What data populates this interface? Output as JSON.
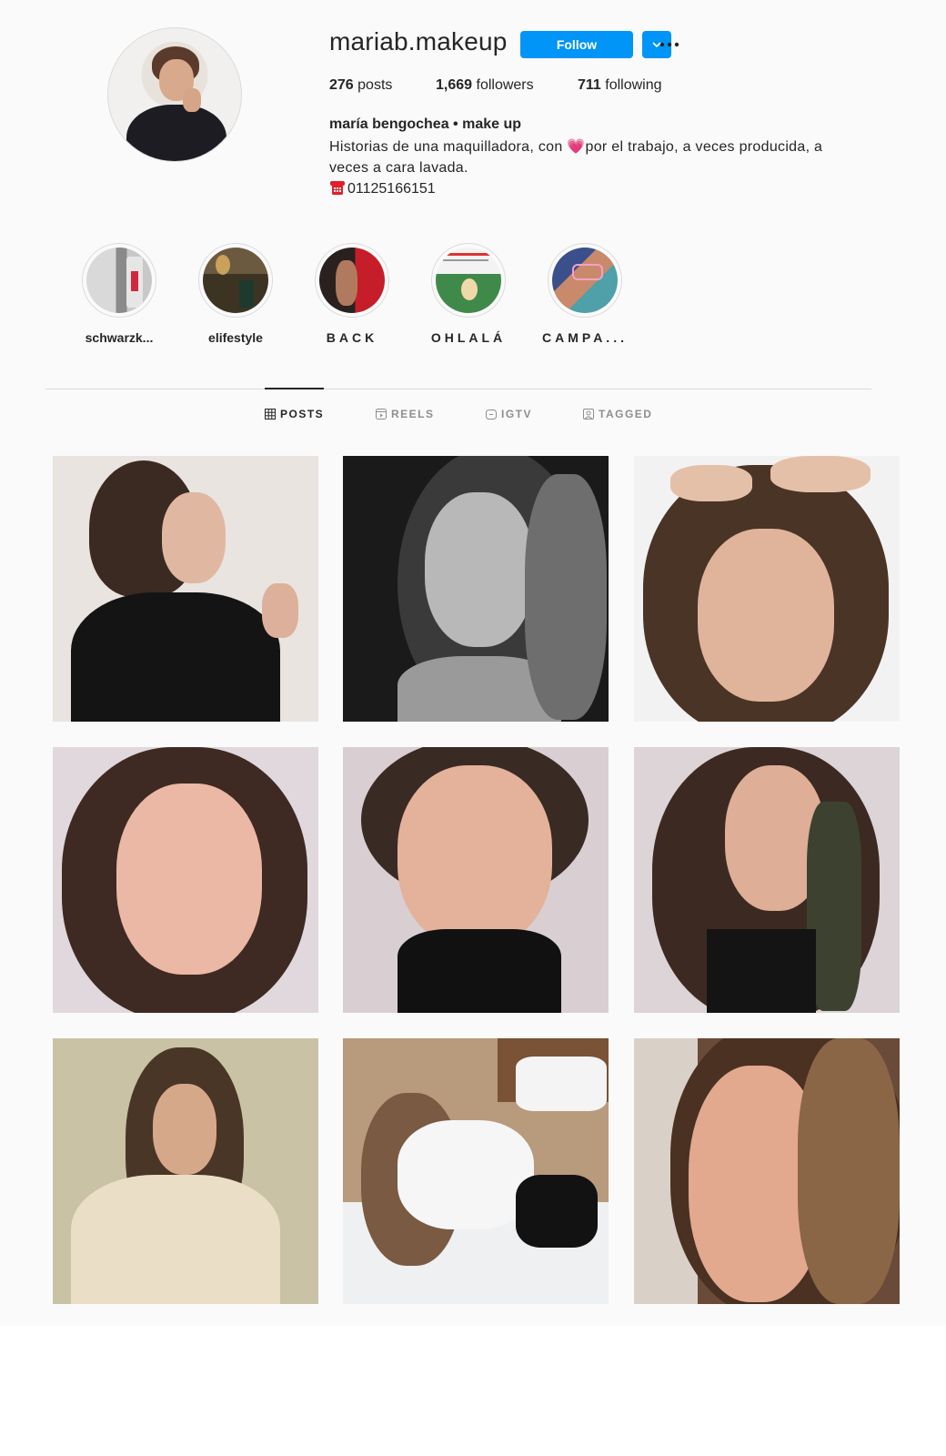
{
  "profile": {
    "username": "mariab.makeup",
    "follow_label": "Follow",
    "stats": {
      "posts_count": "276",
      "posts_label": "posts",
      "followers_count": "1,669",
      "followers_label": "followers",
      "following_count": "711",
      "following_label": "following"
    },
    "full_name": "maría bengochea • make up",
    "bio": "Historias de una maquilladora, con 💗por el trabajo, a veces producida, a veces a cara lavada.",
    "phone": "01125166151"
  },
  "highlights": [
    {
      "label": "schwarzk..."
    },
    {
      "label": "elifestyle"
    },
    {
      "label": "BACK"
    },
    {
      "label": "OHLALÁ"
    },
    {
      "label": "CAMPA..."
    }
  ],
  "tabs": [
    {
      "label": "POSTS",
      "icon": "grid-icon",
      "active": true
    },
    {
      "label": "REELS",
      "icon": "reels-icon",
      "active": false
    },
    {
      "label": "IGTV",
      "icon": "igtv-icon",
      "active": false
    },
    {
      "label": "TAGGED",
      "icon": "tagged-icon",
      "active": false
    }
  ],
  "posts_grid": {
    "rows": 3,
    "columns": 3,
    "posts": [
      {
        "description_icon": "portrait-photo"
      },
      {
        "description_icon": "portrait-photo"
      },
      {
        "description_icon": "portrait-photo"
      },
      {
        "description_icon": "portrait-photo"
      },
      {
        "description_icon": "portrait-photo"
      },
      {
        "description_icon": "portrait-photo"
      },
      {
        "description_icon": "portrait-photo"
      },
      {
        "description_icon": "portrait-photo"
      },
      {
        "description_icon": "portrait-photo"
      }
    ]
  },
  "colors": {
    "accent": "#0095f6",
    "text": "#262626",
    "muted": "#8e8e8e",
    "border": "#dbdbdb",
    "background": "#fafafa"
  }
}
